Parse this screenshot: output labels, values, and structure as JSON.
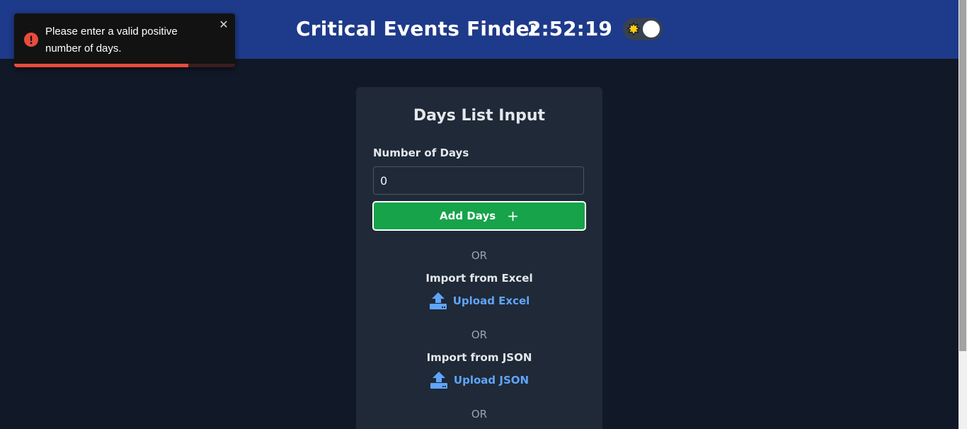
{
  "header": {
    "title": "Critical Events Finder",
    "clock": "2:52:19",
    "theme_toggle_icon": "sun-icon"
  },
  "toast": {
    "message": "Please enter a valid positive number of days.",
    "close_label": "✕",
    "icon": "error-icon",
    "progress": 0.79,
    "color": "#e74c3c"
  },
  "card": {
    "title": "Days List Input",
    "days_label": "Number of Days",
    "days_value": "0",
    "add_button_label": "Add Days",
    "add_button_icon": "+",
    "or_label": "OR",
    "excel": {
      "label": "Import from Excel",
      "link": "Upload Excel",
      "icon": "upload-icon"
    },
    "json": {
      "label": "Import from JSON",
      "link": "Upload JSON",
      "icon": "upload-icon"
    }
  },
  "colors": {
    "header_bg": "#1e3a8a",
    "page_bg": "#111827",
    "card_bg": "#1f2937",
    "button_green": "#16a34a",
    "link_blue": "#60a5fa"
  }
}
